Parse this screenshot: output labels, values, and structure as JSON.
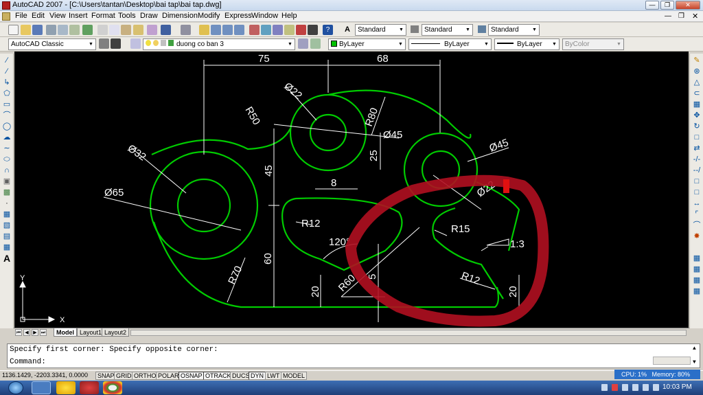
{
  "window": {
    "title": "AutoCAD 2007 - [C:\\Users\\tantan\\Desktop\\bai tap\\bai tap.dwg]"
  },
  "menu": [
    "File",
    "Edit",
    "View",
    "Insert",
    "Format",
    "Tools",
    "Draw",
    "Dimension",
    "Modify",
    "Express",
    "Window",
    "Help"
  ],
  "toolbar": {
    "text_style": "Standard",
    "dim_style": "Standard",
    "table_style": "Standard",
    "workspace": "AutoCAD Classic",
    "layer": "duong co ban 3",
    "color": "ByLayer",
    "linetype": "ByLayer",
    "lineweight": "ByLayer",
    "plotstyle": "ByColor"
  },
  "drawing": {
    "dims": [
      "75",
      "68",
      "Ø22",
      "R50",
      "R80",
      "Ø45",
      "25",
      "Ø45",
      "Ø32",
      "45",
      "8",
      "Ø65",
      "R12",
      "Ø22",
      "R15",
      "1:3",
      "120°",
      "R70",
      "60",
      "20",
      "R60",
      "5",
      "R12",
      "20"
    ],
    "ucs_x": "X",
    "ucs_y": "Y",
    "geometry_color": "#00cc00",
    "dim_color": "#ffffff",
    "annotation_color": "#b01020"
  },
  "layout_tabs": [
    "Model",
    "Layout1",
    "Layout2"
  ],
  "command": {
    "history": "Specify first corner: Specify opposite corner:",
    "prompt": "Command:"
  },
  "status": {
    "coords": "1136.1429, -2203.3341, 0.0000",
    "buttons": [
      "SNAP",
      "GRID",
      "ORTHO",
      "POLAR",
      "OSNAP",
      "OTRACK",
      "DUCS",
      "DYN",
      "LWT",
      "MODEL"
    ],
    "cpu": "CPU: 1%",
    "memory": "Memory: 80%"
  },
  "taskbar": {
    "clock": "10:03 PM"
  }
}
